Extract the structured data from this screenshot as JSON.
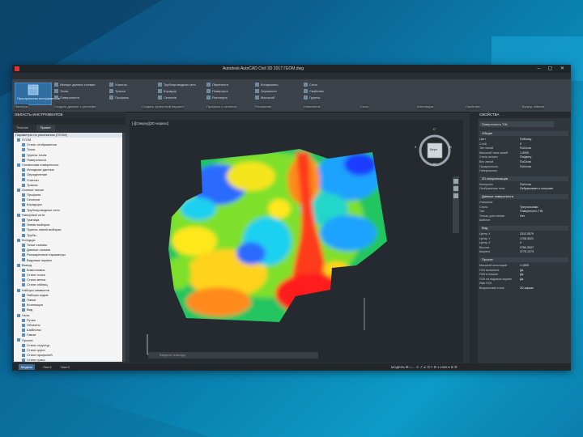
{
  "app": {
    "title": "Autodesk AutoCAD Civil 3D 2017  ГЕОМ.dwg",
    "brand_color": "#d32f2f"
  },
  "ribbon_tabs": [
    "Главная",
    "Вставка",
    "Аннотации",
    "Изменить",
    "Анализ",
    "Вид",
    "Вывод",
    "Управление",
    "Геолокация",
    "Облака точек",
    "Приложения",
    "Надстройки",
    "Express Tools",
    "Совместная работа",
    "Инструменты для разработки"
  ],
  "ribbon": {
    "big_tool_label": "Пространство инструментов",
    "groups": [
      {
        "rows": [
          "Импорт данных съемки",
          "Точки",
          "Поверхности"
        ]
      },
      {
        "rows": [
          "Участок",
          "Трасса",
          "Профиль"
        ]
      },
      {
        "rows": [
          "Трубопроводная сеть",
          "Коридор",
          "Сечения"
        ]
      },
      {
        "rows": [
          "Перенести",
          "Повернуть",
          "Растянуть"
        ]
      },
      {
        "rows": [
          "Копировать",
          "Зеркально",
          "Масштаб"
        ]
      },
      {
        "rows": [
          "Слои",
          "Свойства",
          "Группы"
        ]
      }
    ],
    "panel_titles": [
      "Палитры",
      "Создать данные о рельефе",
      "Создать проектный вариант",
      "Профиль и сечения",
      "Рисование",
      "Изменение",
      "Слои",
      "Аннотации",
      "Свойства",
      "Буфер обмена"
    ]
  },
  "toolspace": {
    "title": "ОБЛАСТЬ ИНСТРУМЕНТОВ",
    "tabs": [
      "Тематик",
      "Проект"
    ],
    "root": "Параметры по умолчанию (ГЕОМ)",
    "items": [
      "ГЕОМ",
      "Стиль отображения",
      "Точки",
      "Группы точек",
      "Поверхности",
      "Съемочная поверхность",
      "Исходные данные",
      "Определение",
      "Участки",
      "Трассы",
      "Осевые линии",
      "Профили",
      "Сечения",
      "Коридоры",
      "Трубопроводные сети",
      "Напорные сети",
      "Граница",
      "Линии выборки",
      "Группы линий выборки",
      "Трубы",
      "Колодцы",
      "Точки съемки",
      "Данные съемки",
      "Расширенные параметры",
      "Видовые экраны",
      "Вывод",
      "Компоновка",
      "Стили точек",
      "Стили меток",
      "Стили таблиц",
      "Наборы символов",
      "Наборы кодов",
      "Папки",
      "Коллекции",
      "Вид",
      "Узлы",
      "Ручки",
      "Объекты",
      "Шаблоны",
      "Связи",
      "Прочее",
      "Стили структур",
      "Стили групп",
      "Стили профилей",
      "Стили трасс",
      "Стили коридоров",
      "Стили сечений"
    ],
    "bottom_tabs": [
      "Модель",
      "Лист1",
      "Лист2"
    ]
  },
  "canvas": {
    "viewport_label": "[-][Сверху][2D-каркас]",
    "viewcube_label": "Верх",
    "compass_n": "С",
    "compass_s": "Ю",
    "compass_e": "В",
    "compass_w": "З",
    "command_placeholder": "Введите команду"
  },
  "properties": {
    "title": "СВОЙСТВА",
    "selection": "Поверхность TIN",
    "sections": [
      {
        "name": "Общие",
        "rows": [
          [
            "Цвет",
            "ПоБлоку"
          ],
          [
            "Слой",
            "0"
          ],
          [
            "Тип линий",
            "ПоСлою"
          ],
          [
            "Масштаб типа линий",
            "1.0000"
          ],
          [
            "Стиль печати",
            "ПоЦвету"
          ],
          [
            "Вес линий",
            "ПоСлою"
          ],
          [
            "Прозрачность",
            "ПоСлою"
          ],
          [
            "Гиперссылка",
            ""
          ]
        ]
      },
      {
        "name": "3D-визуализация",
        "rows": [
          [
            "Материал",
            "ПоСлою"
          ],
          [
            "Отображение тени",
            "Отбрасывает и получает"
          ]
        ]
      },
      {
        "name": "Данные поверхности",
        "rows": [
          [
            "Описание",
            ""
          ],
          [
            "Стиль",
            "Треугольники"
          ],
          [
            "Тип",
            "Поверхность TIN"
          ],
          [
            "Только для чтения",
            "Нет"
          ],
          [
            "Шаблон",
            ""
          ]
        ]
      },
      {
        "name": "Вид",
        "rows": [
          [
            "Центр X",
            "2312.0570"
          ],
          [
            "Центр Y",
            "1708.4021"
          ],
          [
            "Центр Z",
            "0"
          ],
          [
            "Высота",
            "2760.3027"
          ],
          [
            "Ширина",
            "3775.1373"
          ]
        ]
      },
      {
        "name": "Прочее",
        "rows": [
          [
            "Масштаб аннотаций",
            "1:1000"
          ],
          [
            "ПСК включена",
            "Да"
          ],
          [
            "ПСК в начале",
            "Да"
          ],
          [
            "ПСК на видовом экране",
            "Да"
          ],
          [
            "Имя ПСК",
            ""
          ],
          [
            "Визуальный стиль",
            "2D-каркас"
          ]
        ]
      }
    ]
  },
  "statusbar": {
    "model": "МОДЕЛЬ",
    "layouts": [
      "Модель",
      "Лист1",
      "Лист2"
    ],
    "right": "МОДЕЛЬ  ⊞ ⁞⁞ ∟ ⊙ ↗ ∠ ⊡ ≡ ⚙  1:1000 ▾  ⊕  ☰"
  }
}
